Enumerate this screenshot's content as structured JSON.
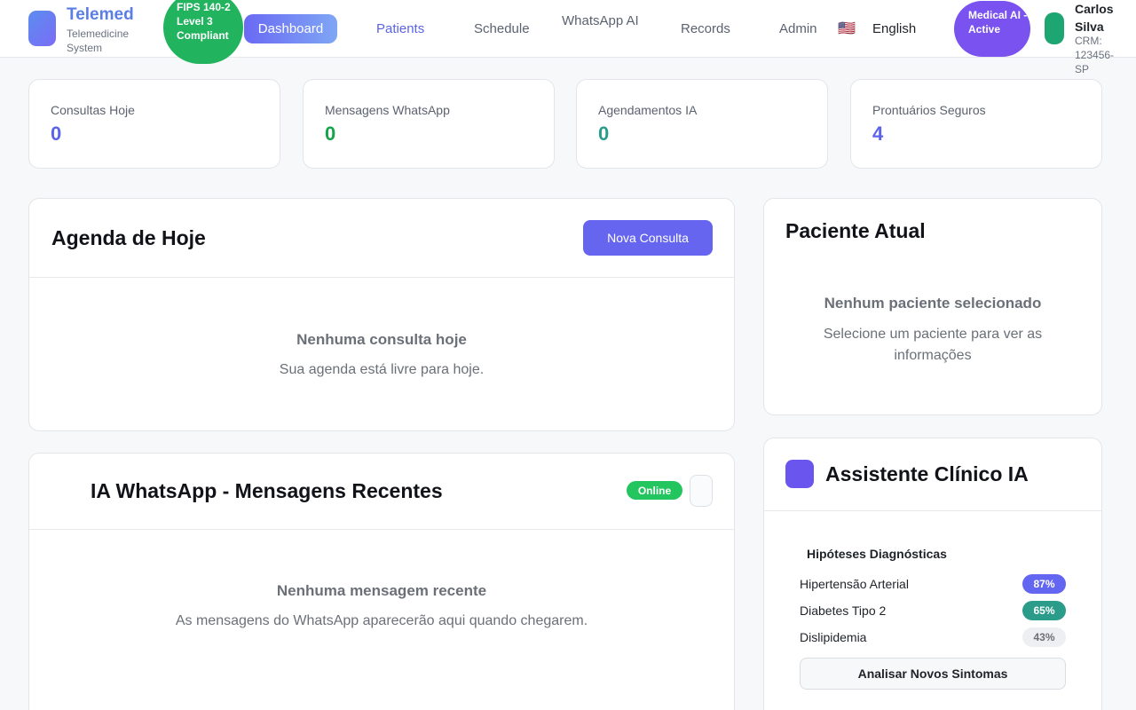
{
  "header": {
    "brand_name": "Telemed",
    "brand_sub": "Telemedicine System",
    "fips_badge": "FIPS 140-2 Level 3 Compliant",
    "nav": {
      "dashboard": "Dashboard",
      "patients": "Patients",
      "schedule": "Schedule",
      "whatsapp_ai": "WhatsApp AI",
      "records": "Records",
      "admin": "Admin"
    },
    "language_flag": "🇺🇸",
    "language": "English",
    "ai_status": "Medical AI - Active",
    "user_name": "Carlos Silva",
    "user_crm": "CRM: 123456-SP"
  },
  "stats": [
    {
      "label": "Consultas Hoje",
      "value": "0",
      "color": "#5b63e8"
    },
    {
      "label": "Mensagens WhatsApp",
      "value": "0",
      "color": "#16a34a"
    },
    {
      "label": "Agendamentos IA",
      "value": "0",
      "color": "#2b9c8a"
    },
    {
      "label": "Prontuários Seguros",
      "value": "4",
      "color": "#5b63e8"
    }
  ],
  "agenda": {
    "title": "Agenda de Hoje",
    "new_button": "Nova Consulta",
    "empty_title": "Nenhuma consulta hoje",
    "empty_sub": "Sua agenda está livre para hoje."
  },
  "whatsapp": {
    "title": "IA WhatsApp - Mensagens Recentes",
    "status": "Online",
    "empty_title": "Nenhuma mensagem recente",
    "empty_sub": "As mensagens do WhatsApp aparecerão aqui quando chegarem."
  },
  "patient": {
    "title": "Paciente Atual",
    "empty_title": "Nenhum paciente selecionado",
    "empty_sub": "Selecione um paciente para ver as informações"
  },
  "assistant": {
    "title": "Assistente Clínico IA",
    "hypotheses_title": "Hipóteses Diagnósticas",
    "hypotheses": [
      {
        "name": "Hipertensão Arterial",
        "pct": "87%",
        "bg": "#6366f1",
        "fg": "#ffffff"
      },
      {
        "name": "Diabetes Tipo 2",
        "pct": "65%",
        "bg": "#2b9c8a",
        "fg": "#ffffff"
      },
      {
        "name": "Dislipidemia",
        "pct": "43%",
        "bg": "#eeeff2",
        "fg": "#6b7078"
      }
    ],
    "analyze_button": "Analisar Novos Sintomas"
  }
}
